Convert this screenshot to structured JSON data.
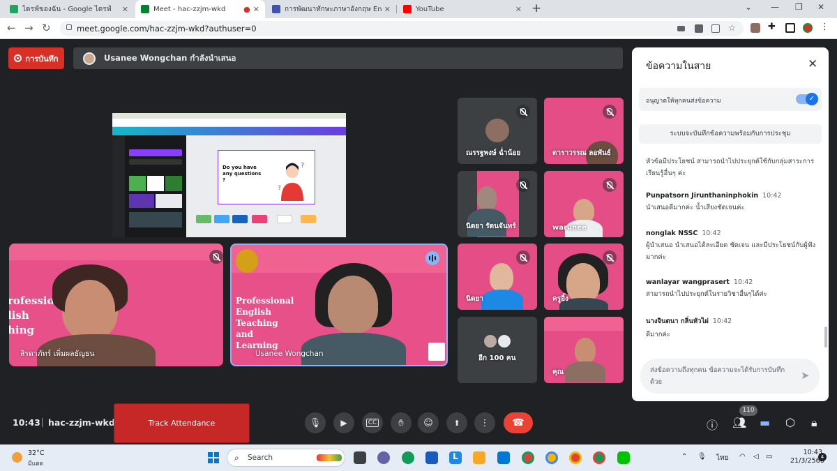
{
  "browser": {
    "tabs": [
      {
        "label": "ไดรฟ์ของฉัน - Google ไดรฟ์",
        "icon": "google-drive-icon",
        "color": "#1fa463"
      },
      {
        "label": "Meet - hac-zzjm-wkd",
        "icon": "google-meet-icon",
        "color": "#00832d"
      },
      {
        "label": "การพัฒนาทักษะภาษาอังกฤษ English",
        "icon": "google-forms-icon",
        "color": "#3f51b5"
      },
      {
        "label": "YouTube",
        "icon": "youtube-icon",
        "color": "#ff0000"
      }
    ],
    "url": "meet.google.com/hac-zzjm-wkd?authuser=0"
  },
  "meet": {
    "record_label": "การบันทึก",
    "presenter_text": "Usanee Wongchan กำลังนำเสนอ",
    "shared_screen": {
      "slide_question": "Do you have any questions ?"
    },
    "main_tiles": [
      {
        "name": "สิรดาภัทร์ เพิ่มผลธัญธน",
        "overlay": "Professional English Teaching and Learning"
      },
      {
        "name": "Usanee Wongchan",
        "overlay": "Professional English Teaching and Learning Community"
      }
    ],
    "participants": [
      {
        "name": "ณรรฐพงษ์ ฉ่ำน้อย"
      },
      {
        "name": "ดาราวรรณ ลอพันธ์"
      },
      {
        "name": "นิตยา รัตนจันทร์"
      },
      {
        "name": "warunee"
      },
      {
        "name": "นิตยา"
      },
      {
        "name": "ครูอิ้ง"
      },
      {
        "name": "อีก 100 คน"
      },
      {
        "name": "คุณ"
      }
    ],
    "meeting_time": "10:43",
    "meeting_code": "hac-zzjm-wkd",
    "track_attendance_label": "Track Attendance",
    "participant_count": "110"
  },
  "chat": {
    "title": "ข้อความในสาย",
    "allow_label": "อนุญาตให้ทุกคนส่งข้อความ",
    "allow_enabled": true,
    "system_note": "ระบบจะบันทึกข้อความพร้อมกับการประชุม",
    "messages": [
      {
        "sender": "",
        "time": "",
        "text": "หัวข้อมีประโยชน์ สามารถนำไปประยุกต์ใช้กับกลุ่มสาระการเรียนรู้อื่นๆ ค่ะ"
      },
      {
        "sender": "Punpatsorn Jirunthaninphokin",
        "time": "10:42",
        "text": "นำเสนอดีมากค่ะ น้ำเสียงชัดเจนค่ะ"
      },
      {
        "sender": "nonglak NSSC",
        "time": "10:42",
        "text": "ผู้นำเสนอ นำเสนอได้ละเอียด ชัดเจน และมีประโยชน์กับผู้ฟังมากค่ะ"
      },
      {
        "sender": "wanlayar wangprasert",
        "time": "10:42",
        "text": "สามารถนำไปประยุกต์ในรายวิชาอื่นๆได้ค่ะ"
      },
      {
        "sender": "นางจินตนา กลิ่นหัวไผ่",
        "time": "10:42",
        "text": "ดีมากค่ะ"
      }
    ],
    "input_placeholder": "ส่งข้อความถึงทุกคน ข้อความจะได้รับการบันทึกด้วย"
  },
  "taskbar": {
    "temperature": "32°C",
    "weather": "มีแดด",
    "search_label": "Search",
    "language": "ไทย",
    "time": "10:43",
    "date": "21/3/2566",
    "notifications": "4"
  }
}
